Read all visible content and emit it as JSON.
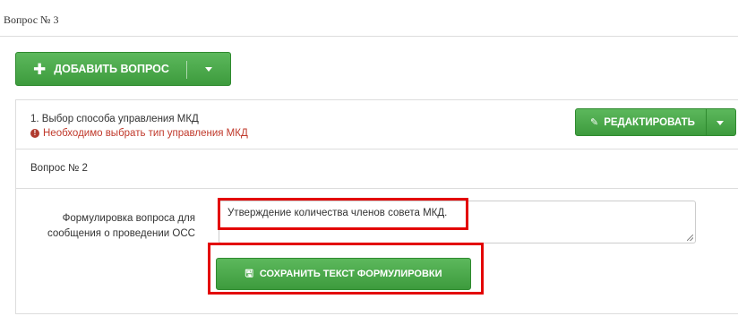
{
  "page": {
    "section_title": "Вопрос № 3"
  },
  "toolbar": {
    "add_question_label": "ДОБАВИТЬ ВОПРОС"
  },
  "question_1": {
    "title": "1. Выбор способа управления МКД",
    "error_message": "Необходимо выбрать тип управления МКД",
    "edit_label": "РЕДАКТИРОВАТЬ"
  },
  "question_2": {
    "title": "Вопрос № 2",
    "form_label": "Формулировка вопроса для сообщения о проведении ОСС",
    "text_value": "Утверждение количества членов совета МКД.",
    "save_label": "СОХРАНИТЬ ТЕКСТ ФОРМУЛИРОВКИ"
  },
  "icons": {
    "add": "plus-icon",
    "dropdown": "caret-down-icon",
    "edit": "pencil-icon",
    "error": "exclamation-circle-icon",
    "save": "floppy-disk-icon"
  },
  "colors": {
    "button_green": "#4cae4c",
    "error_red": "#c0392b",
    "highlight_red": "#e30000"
  }
}
